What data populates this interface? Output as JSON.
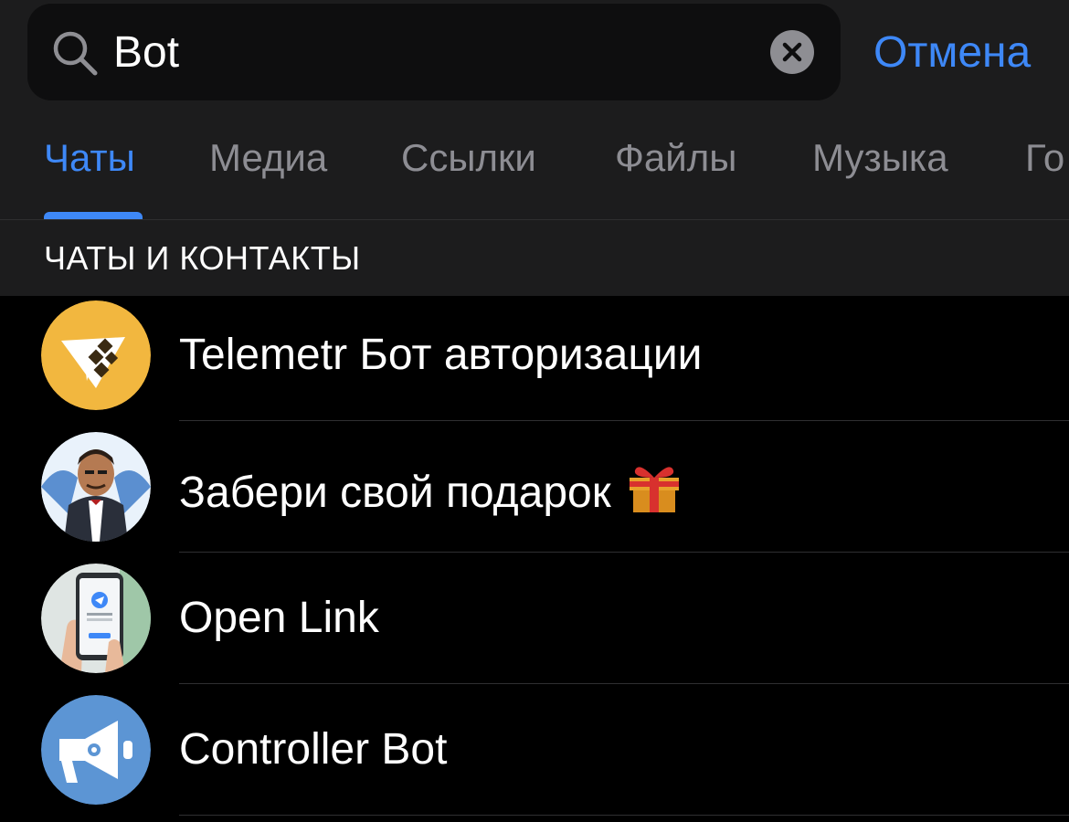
{
  "search": {
    "query": "Bot",
    "cancel_label": "Отмена"
  },
  "tabs": [
    {
      "label": "Чаты",
      "active": true
    },
    {
      "label": "Медиа",
      "active": false
    },
    {
      "label": "Ссылки",
      "active": false
    },
    {
      "label": "Файлы",
      "active": false
    },
    {
      "label": "Музыка",
      "active": false
    },
    {
      "label": "Го",
      "active": false
    }
  ],
  "section": {
    "title": "ЧАТЫ И КОНТАКТЫ"
  },
  "results": [
    {
      "title": "Telemetr Бот авторизации",
      "avatar": "telemetr-logo-avatar"
    },
    {
      "title": "Забери свой подарок",
      "avatar": "cartoon-man-avatar",
      "icon": "gift-icon"
    },
    {
      "title": "Open Link",
      "avatar": "hand-holding-phone-avatar"
    },
    {
      "title": "Controller Bot",
      "avatar": "megaphone-avatar"
    }
  ],
  "colors": {
    "accent": "#3e88f7",
    "background": "#000000",
    "header_background": "#1c1c1d",
    "secondary_text": "#8d8d93"
  }
}
